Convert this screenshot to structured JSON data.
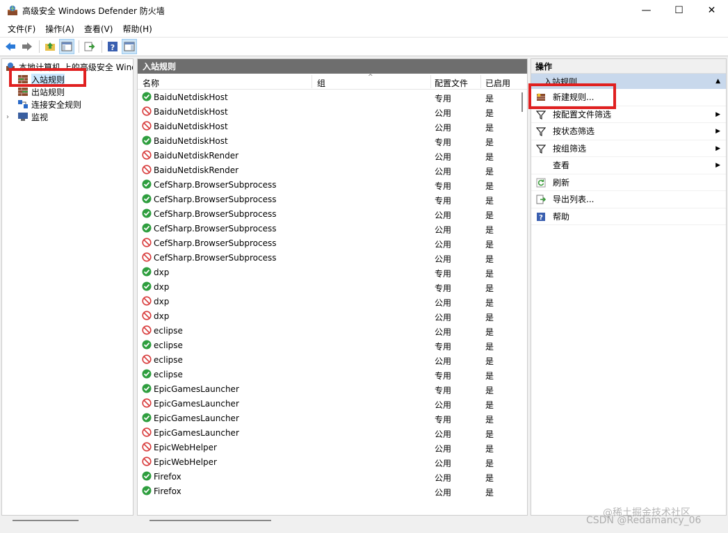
{
  "window": {
    "title": "高级安全 Windows Defender 防火墙",
    "minimize": "—",
    "maximize": "☐",
    "close": "✕"
  },
  "menu": [
    "文件(F)",
    "操作(A)",
    "查看(V)",
    "帮助(H)"
  ],
  "tree": {
    "root": "本地计算机 上的高级安全 Windows Defender 防火墙",
    "items": [
      "入站规则",
      "出站规则",
      "连接安全规则",
      "监视"
    ]
  },
  "center": {
    "header": "入站规则",
    "columns": {
      "name": "名称",
      "group": "组",
      "profile": "配置文件",
      "enabled": "已启用"
    },
    "rows": [
      {
        "name": "BaiduNetdiskHost",
        "profile": "专用",
        "enabled": "是",
        "allow": true
      },
      {
        "name": "BaiduNetdiskHost",
        "profile": "公用",
        "enabled": "是",
        "allow": false
      },
      {
        "name": "BaiduNetdiskHost",
        "profile": "公用",
        "enabled": "是",
        "allow": false
      },
      {
        "name": "BaiduNetdiskHost",
        "profile": "专用",
        "enabled": "是",
        "allow": true
      },
      {
        "name": "BaiduNetdiskRender",
        "profile": "公用",
        "enabled": "是",
        "allow": false
      },
      {
        "name": "BaiduNetdiskRender",
        "profile": "公用",
        "enabled": "是",
        "allow": false
      },
      {
        "name": "CefSharp.BrowserSubprocess",
        "profile": "专用",
        "enabled": "是",
        "allow": true
      },
      {
        "name": "CefSharp.BrowserSubprocess",
        "profile": "专用",
        "enabled": "是",
        "allow": true
      },
      {
        "name": "CefSharp.BrowserSubprocess",
        "profile": "公用",
        "enabled": "是",
        "allow": true
      },
      {
        "name": "CefSharp.BrowserSubprocess",
        "profile": "公用",
        "enabled": "是",
        "allow": true
      },
      {
        "name": "CefSharp.BrowserSubprocess",
        "profile": "公用",
        "enabled": "是",
        "allow": false
      },
      {
        "name": "CefSharp.BrowserSubprocess",
        "profile": "公用",
        "enabled": "是",
        "allow": false
      },
      {
        "name": "dxp",
        "profile": "专用",
        "enabled": "是",
        "allow": true
      },
      {
        "name": "dxp",
        "profile": "专用",
        "enabled": "是",
        "allow": true
      },
      {
        "name": "dxp",
        "profile": "公用",
        "enabled": "是",
        "allow": false
      },
      {
        "name": "dxp",
        "profile": "公用",
        "enabled": "是",
        "allow": false
      },
      {
        "name": "eclipse",
        "profile": "公用",
        "enabled": "是",
        "allow": false
      },
      {
        "name": "eclipse",
        "profile": "专用",
        "enabled": "是",
        "allow": true
      },
      {
        "name": "eclipse",
        "profile": "公用",
        "enabled": "是",
        "allow": false
      },
      {
        "name": "eclipse",
        "profile": "专用",
        "enabled": "是",
        "allow": true
      },
      {
        "name": "EpicGamesLauncher",
        "profile": "专用",
        "enabled": "是",
        "allow": true
      },
      {
        "name": "EpicGamesLauncher",
        "profile": "公用",
        "enabled": "是",
        "allow": false
      },
      {
        "name": "EpicGamesLauncher",
        "profile": "专用",
        "enabled": "是",
        "allow": true
      },
      {
        "name": "EpicGamesLauncher",
        "profile": "公用",
        "enabled": "是",
        "allow": false
      },
      {
        "name": "EpicWebHelper",
        "profile": "公用",
        "enabled": "是",
        "allow": false
      },
      {
        "name": "EpicWebHelper",
        "profile": "公用",
        "enabled": "是",
        "allow": false
      },
      {
        "name": "Firefox",
        "profile": "公用",
        "enabled": "是",
        "allow": true
      },
      {
        "name": "Firefox",
        "profile": "公用",
        "enabled": "是",
        "allow": true
      }
    ]
  },
  "right": {
    "header": "操作",
    "section": "入站规则",
    "actions": [
      {
        "label": "新建规则...",
        "icon": "new-rule-icon",
        "submenu": false
      },
      {
        "label": "按配置文件筛选",
        "icon": "filter-icon",
        "submenu": true
      },
      {
        "label": "按状态筛选",
        "icon": "filter-icon",
        "submenu": true
      },
      {
        "label": "按组筛选",
        "icon": "filter-icon",
        "submenu": true
      },
      {
        "label": "查看",
        "icon": "",
        "submenu": true
      },
      {
        "label": "刷新",
        "icon": "refresh-icon",
        "submenu": false
      },
      {
        "label": "导出列表...",
        "icon": "export-icon",
        "submenu": false
      },
      {
        "label": "帮助",
        "icon": "help-icon",
        "submenu": false
      }
    ]
  },
  "watermark": {
    "line1": "@稀土掘金技术社区",
    "line2": "CSDN @Redamancy_06"
  },
  "colors": {
    "allow": "#2e9e3e",
    "block": "#d83b3b",
    "highlight": "#e02020",
    "section": "#c8d8ec",
    "header": "#6e6e6e"
  }
}
